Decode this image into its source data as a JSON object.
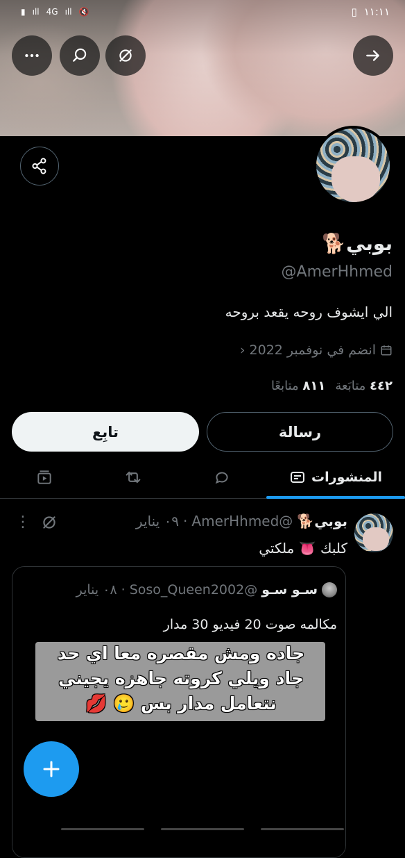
{
  "status_bar": {
    "time": "١١:١١",
    "left_icons": "4G"
  },
  "profile": {
    "display_name": "بوبي🐕",
    "handle": "@AmerHhmed",
    "bio": "الي ايشوف روحه يقعد بروحه",
    "joined": "انضم في نوفمبر 2022",
    "following_count": "٤٤٢",
    "following_label": "متابَعة",
    "followers_count": "٨١١",
    "followers_label": "متابعًا"
  },
  "actions": {
    "follow_label": "تابِع",
    "message_label": "رسالة"
  },
  "tabs": {
    "posts_label": "المنشورات"
  },
  "tweet": {
    "name": "بوبي🐕",
    "handle": "@AmerHhmed",
    "date": "٠٩ يناير",
    "dot": "·",
    "text": "كلبك 👅 ملكتي",
    "quote": {
      "name": "سـو سـو",
      "handle": "@Soso_Queen2002",
      "date": "٠٨ يناير",
      "dot": "·",
      "text": "مكالمه صوت 20 فيديو 30 مدار",
      "overlay_lines": [
        "جاده ومش مقصره معا اي حد",
        "جاد ويلي كروته جاهزه يجيني",
        "نتعامل مدار بس 🥲 💋"
      ]
    }
  },
  "colors": {
    "accent": "#1d9bf0",
    "background": "#000000",
    "secondary_text": "#71767b"
  }
}
